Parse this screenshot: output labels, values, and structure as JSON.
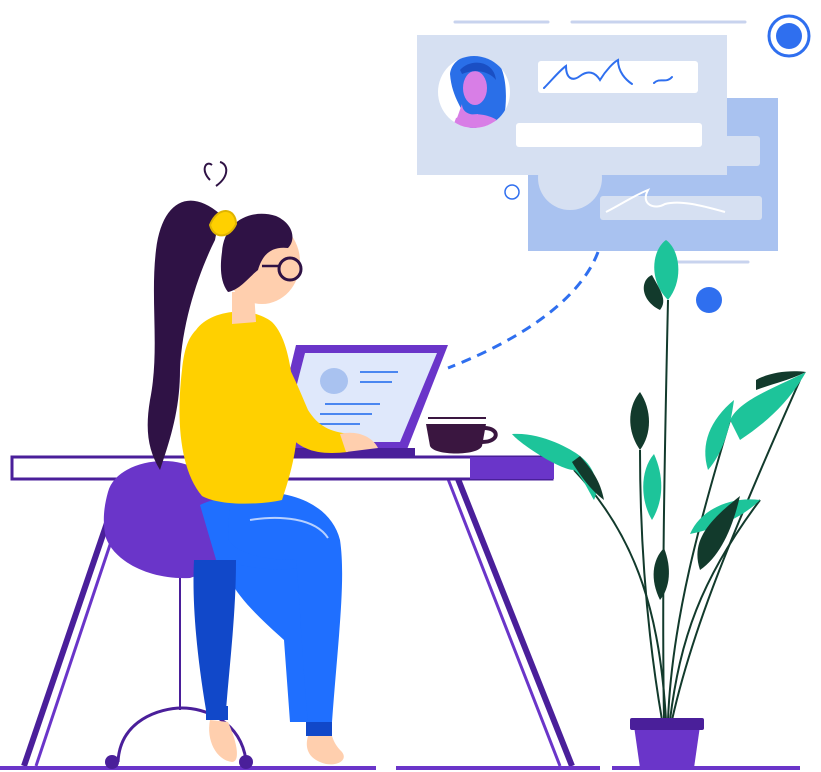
{
  "illustration": {
    "colors": {
      "purple": "#6a35c9",
      "purple_dark": "#4a1f9a",
      "hair": "#2f1245",
      "skin": "#ffcfae",
      "shirt": "#ffd000",
      "jeans": "#1f6fff",
      "jeans_dark": "#1148c9",
      "card_front": "#d6e0f2",
      "card_back": "#a9c2f0",
      "accent_blue": "#2f6fef",
      "leaf_green": "#1dc49a",
      "leaf_dark": "#123a2c",
      "mug": "#3a1640",
      "line_light": "#c8d3ee"
    },
    "icons": [
      "profile-card-icon",
      "signature-scribble-icon",
      "record-dot-icon",
      "laptop-icon",
      "mug-icon",
      "potted-plant-icon"
    ]
  }
}
